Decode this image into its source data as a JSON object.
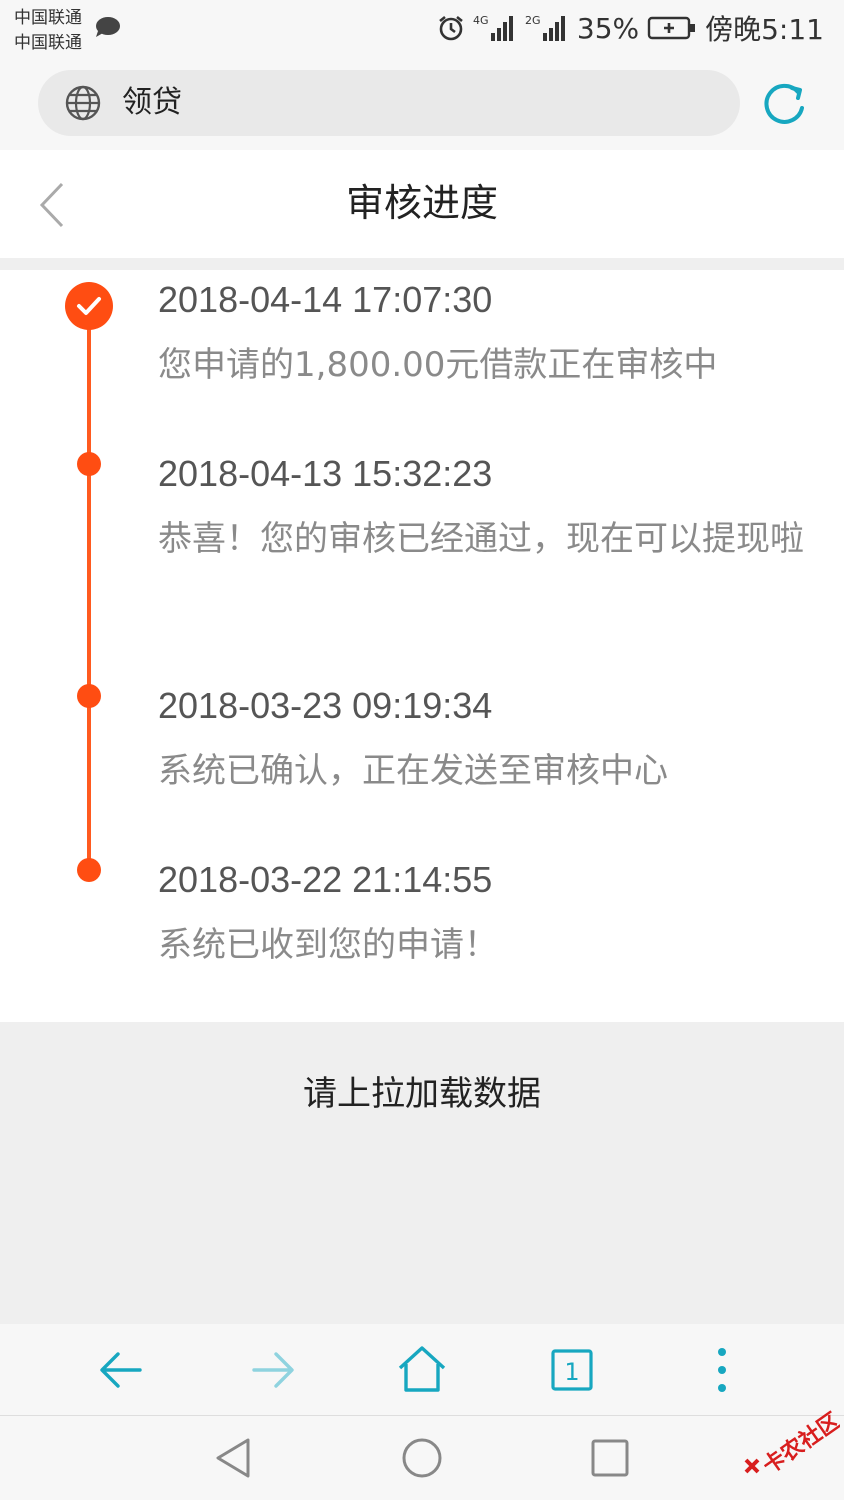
{
  "status_bar": {
    "carrier_1": "中国联通",
    "carrier_2": "中国联通",
    "network_1": "4G",
    "network_2": "2G",
    "battery_percent": "35%",
    "time": "傍晚5:11",
    "icons": [
      "message-icon",
      "alarm-icon",
      "signal-icon",
      "battery-icon"
    ]
  },
  "address_bar": {
    "title": "领贷",
    "icons": [
      "globe-icon",
      "refresh-icon"
    ]
  },
  "header": {
    "title": "审核进度",
    "back_icon": "chevron-left-icon"
  },
  "timeline": [
    {
      "time": "2018-04-14 17:07:30",
      "desc": "您申请的1,800.00元借款正在审核中",
      "current": true
    },
    {
      "time": "2018-04-13 15:32:23",
      "desc": "恭喜！您的审核已经通过，现在可以提现啦",
      "current": false
    },
    {
      "time": "2018-03-23 09:19:34",
      "desc": "系统已确认，正在发送至审核中心",
      "current": false
    },
    {
      "time": "2018-03-22 21:14:55",
      "desc": "系统已收到您的申请！",
      "current": false
    }
  ],
  "load_more": "请上拉加载数据",
  "toolbar": {
    "tab_count": "1",
    "icons": [
      "arrow-left-icon",
      "arrow-right-icon",
      "home-icon",
      "tabs-icon",
      "more-icon"
    ]
  },
  "navbar": {
    "icons": [
      "nav-back-icon",
      "nav-home-icon",
      "nav-recents-icon"
    ]
  },
  "watermark": "卡农社区",
  "colors": {
    "accent": "#ff4d12",
    "toolbar_teal": "#17a7c0"
  }
}
